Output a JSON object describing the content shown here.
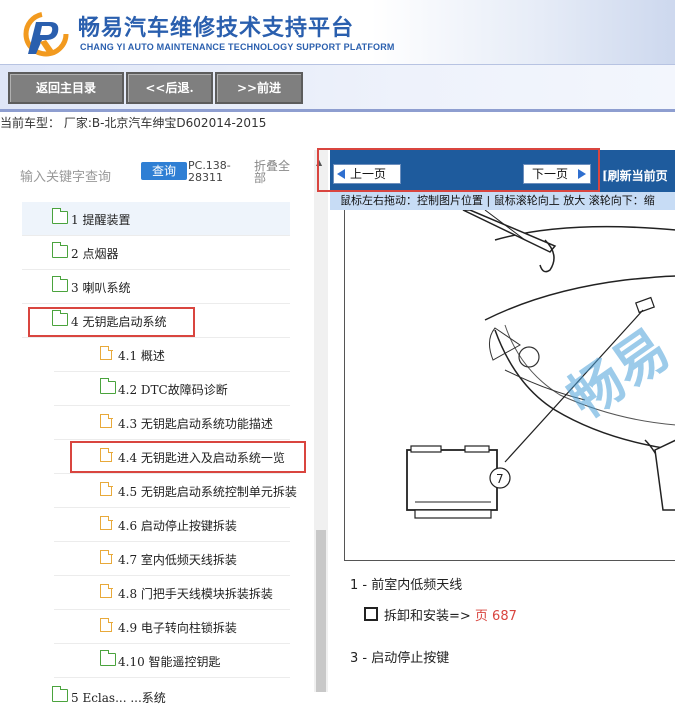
{
  "header": {
    "title": "畅易汽车维修技术支持平台",
    "subtitle": "CHANG YI AUTO MAINTENANCE TECHNOLOGY SUPPORT PLATFORM",
    "brand_color": "#2a5fae"
  },
  "nav": {
    "home_label": "返回主目录",
    "back_label": "<<后退.",
    "forward_label": ">>前进"
  },
  "vehicle": {
    "text": "当前车型：  厂家:B-北京汽车绅宝D602014-2015"
  },
  "search": {
    "placeholder": "输入关键字查询",
    "button_label": "查询",
    "code": "PC.138-28311",
    "collapse_label": "折叠全部"
  },
  "tree": {
    "items": [
      {
        "label": "1 提醒装置",
        "type": "folder",
        "level": 1
      },
      {
        "label": "2 点烟器",
        "type": "folder",
        "level": 1
      },
      {
        "label": "3 喇叭系统",
        "type": "folder",
        "level": 1
      },
      {
        "label": "4 无钥匙启动系统",
        "type": "folder-open",
        "level": 1,
        "highlighted": true
      },
      {
        "label": "4.1 概述",
        "type": "doc",
        "level": 2
      },
      {
        "label": "4.2 DTC故障码诊断",
        "type": "folder",
        "level": 2
      },
      {
        "label": "4.3 无钥匙启动系统功能描述",
        "type": "doc",
        "level": 2
      },
      {
        "label": "4.4 无钥匙进入及启动系统一览",
        "type": "doc",
        "level": 2,
        "highlighted": true
      },
      {
        "label": "4.5 无钥匙启动系统控制单元拆装",
        "type": "doc",
        "level": 2
      },
      {
        "label": "4.6 启动停止按键拆装",
        "type": "doc",
        "level": 2
      },
      {
        "label": "4.7 室内低频天线拆装",
        "type": "doc",
        "level": 2
      },
      {
        "label": "4.8 门把手天线模块拆装拆装",
        "type": "doc",
        "level": 2
      },
      {
        "label": "4.9 电子转向柱锁拆装",
        "type": "doc",
        "level": 2
      },
      {
        "label": "4.10 智能遥控钥匙",
        "type": "folder",
        "level": 2
      },
      {
        "label": "5 Eclas... ...系统",
        "type": "folder",
        "level": 1
      }
    ]
  },
  "viewer": {
    "prev_label": "上一页",
    "next_label": "下一页",
    "refresh_label": "[刷新当前页",
    "hint": "鼠标左右拖动：控制图片位置 | 鼠标滚轮向上 放大  滚轮向下：缩",
    "callout_number": "7",
    "watermark": "畅易",
    "caption1": "1 - 前室内低频天线",
    "caption2_text": "拆卸和安装=> ",
    "caption2_page": "页 687",
    "caption3": "3 - 启动停止按键"
  }
}
